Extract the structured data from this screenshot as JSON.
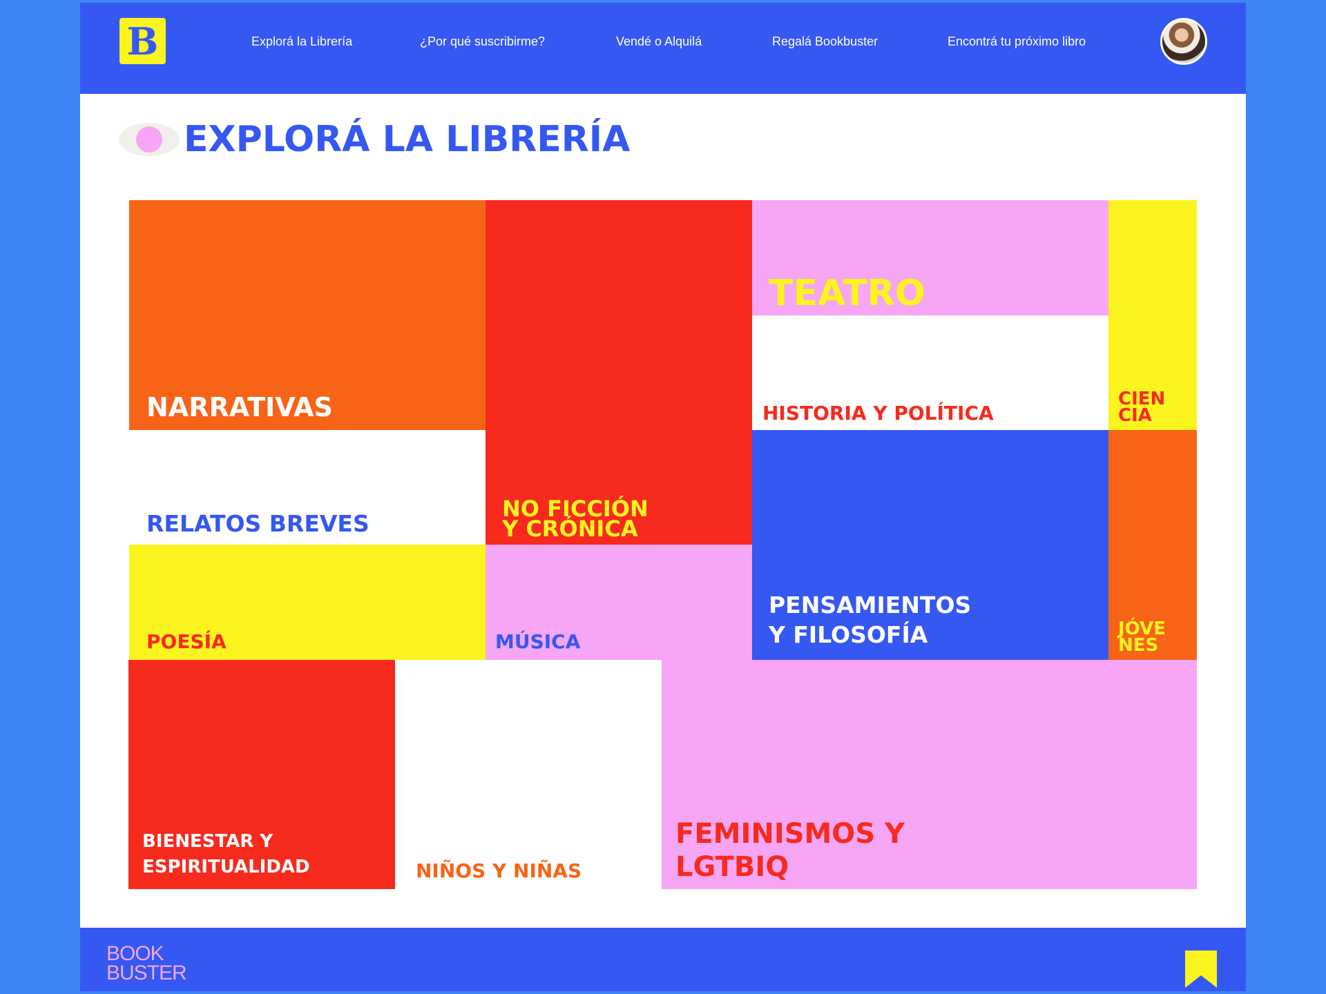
{
  "brand": {
    "logo_letter": "B",
    "footer_logo": "BOOK\nBUSTER",
    "colors": {
      "blue": "#3558f3",
      "yellow": "#fbf41f",
      "orange": "#f86417",
      "red": "#f72a1e",
      "pink": "#f6a6f4",
      "white": "#ffffff"
    }
  },
  "nav": {
    "items": [
      {
        "label": "Explorá la Librería"
      },
      {
        "label": "¿Por qué suscribirme?"
      },
      {
        "label": "Vendé o Alquilá"
      },
      {
        "label": "Regalá Bookbuster"
      },
      {
        "label": "Encontrá tu próximo libro"
      }
    ]
  },
  "page": {
    "title": "EXPLORÁ LA LIBRERÍA"
  },
  "categories": [
    {
      "key": "narrativas",
      "label": "NARRATIVAS",
      "bg": "#f86417",
      "fg": "#ffffff"
    },
    {
      "key": "no-ficcion",
      "label": "NO FICCIÓN\nY CRÓNICA",
      "bg": "#f72a1e",
      "fg": "#fbf41f"
    },
    {
      "key": "teatro",
      "label": "TEATRO",
      "bg": "#f6a6f4",
      "fg": "#fbf41f"
    },
    {
      "key": "historia",
      "label": "HISTORIA Y POLÍTICA",
      "bg": "#ffffff",
      "fg": "#f72a1e"
    },
    {
      "key": "ciencia",
      "label": "CIEN\nCIA",
      "bg": "#fbf41f",
      "fg": "#f72a1e"
    },
    {
      "key": "relatos",
      "label": "RELATOS BREVES",
      "bg": "#ffffff",
      "fg": "#3558f3"
    },
    {
      "key": "pensamientos",
      "label": "PENSAMIENTOS\nY FILOSOFÍA",
      "bg": "#3558f3",
      "fg": "#ffffff"
    },
    {
      "key": "jovenes",
      "label": "JÓVE\nNES",
      "bg": "#f86417",
      "fg": "#fbf41f"
    },
    {
      "key": "poesia",
      "label": "POESÍA",
      "bg": "#fbf41f",
      "fg": "#f72a1e"
    },
    {
      "key": "musica",
      "label": "MÚSICA",
      "bg": "#f6a6f4",
      "fg": "#3558f3"
    },
    {
      "key": "bienestar",
      "label": "BIENESTAR Y\nESPIRITUALIDAD",
      "bg": "#f72a1e",
      "fg": "#ffffff"
    },
    {
      "key": "ninos",
      "label": "NIÑOS Y NIÑAS",
      "bg": "#ffffff",
      "fg": "#f86417"
    },
    {
      "key": "feminismos",
      "label": "FEMINISMOS Y\nLGTBIQ",
      "bg": "#f6a6f4",
      "fg": "#f72a1e"
    }
  ],
  "icons": {
    "eye": "eye-icon",
    "avatar": "user-avatar",
    "bookmark": "bookmark-icon"
  }
}
